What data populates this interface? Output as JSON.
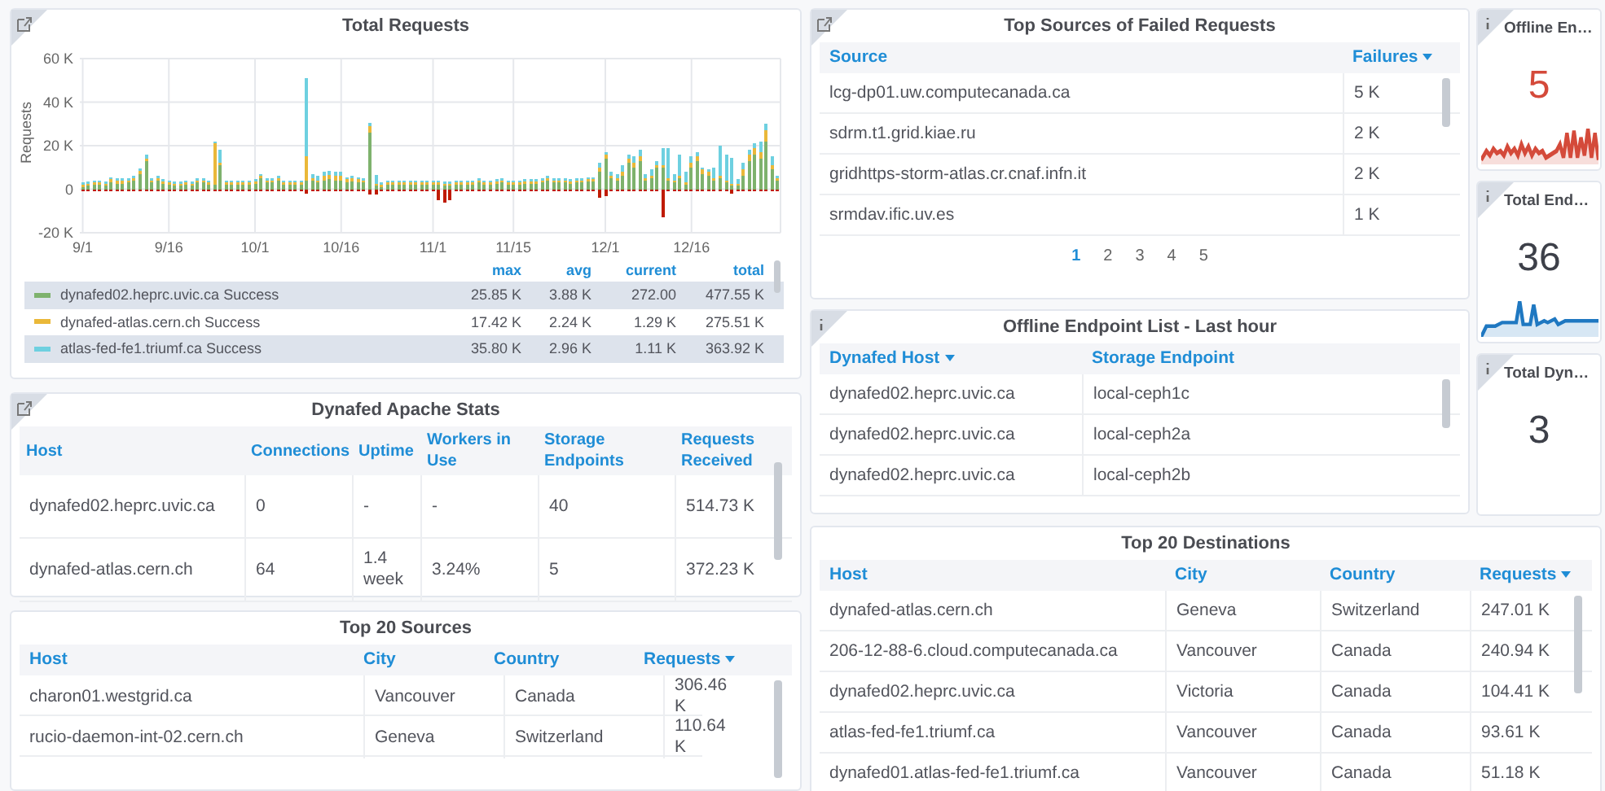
{
  "total_requests": {
    "title": "Total Requests",
    "kind": "link",
    "chart_data": {
      "type": "bar",
      "stacked": true,
      "grid": true,
      "ylabel": "Requests",
      "categories": [
        "9/1",
        null,
        null,
        null,
        null,
        null,
        null,
        null,
        null,
        null,
        null,
        null,
        null,
        null,
        null,
        "9/16",
        null,
        null,
        null,
        null,
        null,
        null,
        null,
        null,
        null,
        null,
        null,
        null,
        null,
        null,
        "10/1",
        null,
        null,
        null,
        null,
        null,
        null,
        null,
        null,
        null,
        null,
        null,
        null,
        null,
        null,
        "10/16",
        null,
        null,
        null,
        null,
        null,
        null,
        null,
        null,
        null,
        null,
        null,
        null,
        null,
        null,
        null,
        "11/1",
        null,
        null,
        null,
        null,
        null,
        null,
        null,
        null,
        null,
        null,
        null,
        null,
        null,
        "11/15",
        null,
        null,
        null,
        null,
        null,
        null,
        null,
        null,
        null,
        null,
        null,
        null,
        null,
        null,
        null,
        "12/1",
        null,
        null,
        null,
        null,
        null,
        null,
        null,
        null,
        null,
        null,
        null,
        null,
        null,
        null,
        "12/16",
        null,
        null,
        null,
        null,
        null,
        null,
        null,
        null,
        null,
        null,
        null,
        null,
        null,
        null,
        null
      ],
      "ylim": [
        -20,
        60
      ],
      "yticks": [
        {
          "value": -20,
          "label": "-20 K"
        },
        {
          "value": 0,
          "label": "0"
        },
        {
          "value": 20,
          "label": "20 K"
        },
        {
          "value": 40,
          "label": "40 K"
        },
        {
          "value": 60,
          "label": "60 K"
        }
      ],
      "series": [
        {
          "color": "#7eb26d",
          "values": [
            1,
            1.5,
            2,
            2,
            1.5,
            3,
            2.5,
            2.5,
            3,
            4,
            7,
            13,
            3,
            4,
            2.5,
            2,
            1.5,
            1.5,
            2,
            1.5,
            3,
            3,
            2,
            2,
            11,
            2,
            2,
            2,
            2,
            2,
            2.5,
            5,
            3,
            3,
            4,
            2,
            2,
            2,
            2,
            4,
            4,
            3,
            4,
            4.5,
            4,
            4,
            3,
            3.5,
            3,
            3,
            26,
            1.5,
            1,
            2,
            2,
            2,
            2,
            2,
            2,
            2,
            2,
            2,
            2,
            1.5,
            1.5,
            2,
            2,
            2,
            2,
            3,
            2,
            2,
            2.5,
            3,
            2,
            2,
            2,
            2.5,
            2.5,
            2.5,
            3,
            4,
            3,
            3,
            3,
            2.5,
            3,
            3,
            3.5,
            3.5,
            8,
            14,
            5,
            4,
            6,
            12,
            10,
            13,
            4,
            5,
            10,
            10,
            4,
            3,
            5,
            2,
            10,
            13,
            7,
            6,
            4,
            5,
            3,
            1.5,
            1.5,
            6,
            13,
            16,
            14,
            22,
            9,
            4
          ]
        },
        {
          "color": "#eab839",
          "values": [
            1,
            1,
            1,
            1,
            1,
            1.5,
            1.5,
            1.5,
            1,
            1,
            1.5,
            1,
            1,
            1,
            1,
            1,
            1,
            1,
            1,
            1,
            1,
            1,
            1,
            19,
            1,
            1,
            1,
            1,
            1,
            1,
            1,
            1,
            1,
            1,
            1,
            1,
            1,
            1,
            1,
            11,
            1,
            1,
            2,
            2,
            2,
            2,
            1.5,
            1.5,
            1.5,
            1,
            3,
            1,
            1,
            1,
            1,
            1,
            1,
            1,
            1,
            1,
            1,
            1,
            1,
            1,
            1,
            1,
            1,
            1,
            1,
            1,
            1,
            1,
            1,
            1,
            1,
            1,
            1,
            1,
            1,
            1,
            1,
            1,
            1,
            1,
            1,
            1,
            1,
            1,
            1,
            1,
            2,
            2,
            1,
            1,
            2,
            2,
            2,
            2,
            1,
            1,
            1,
            1,
            1,
            1,
            1,
            1,
            2,
            2,
            2,
            2,
            1,
            1,
            1,
            1,
            1,
            3,
            3,
            3,
            3,
            5,
            2,
            1
          ]
        },
        {
          "color": "#6ed0e0",
          "values": [
            1,
            1,
            1,
            1,
            1,
            1,
            1,
            1,
            1,
            1,
            1,
            2,
            1,
            1,
            1,
            1,
            1,
            1,
            1,
            1,
            1,
            1,
            1,
            1,
            6,
            1,
            1,
            1,
            1,
            1,
            1,
            1,
            1,
            1,
            1,
            1,
            1,
            1,
            1,
            36,
            2,
            2,
            2,
            2,
            2,
            2,
            1,
            1,
            1,
            1,
            1.5,
            4,
            1,
            1,
            1,
            1,
            1,
            1,
            1,
            1,
            1,
            1,
            1,
            1,
            1,
            1,
            1,
            1,
            1,
            1,
            1,
            1,
            1,
            1,
            1,
            1,
            1,
            1,
            1,
            1,
            1,
            1,
            1,
            1,
            1,
            1,
            1,
            1,
            1,
            1,
            2,
            1,
            2,
            2,
            3,
            2,
            3,
            3,
            2,
            3,
            2,
            8,
            14,
            3,
            10,
            5,
            3,
            2,
            1,
            1,
            5,
            14,
            12,
            12,
            2,
            3,
            2,
            2,
            5,
            3,
            4,
            1
          ]
        },
        {
          "color": "#bf1b00",
          "values": [
            -1,
            -1,
            -1,
            -1,
            -1,
            -1,
            -1,
            -1,
            -1,
            -1,
            -1,
            -1,
            -1,
            -1,
            -1,
            -1,
            -1,
            -1,
            -1,
            -1,
            -1,
            -1,
            -1,
            -1,
            -1,
            -1,
            -1,
            -1,
            -1,
            -1,
            -1,
            -1,
            -1,
            -1,
            -1,
            -1,
            -1,
            -1,
            -1,
            -2,
            -1,
            -1,
            -1,
            -1,
            -1,
            -1,
            -1,
            -1,
            -1,
            -1,
            -2.5,
            -2.5,
            -1,
            -1,
            -1,
            -1,
            -1,
            -1,
            -1,
            -1,
            -1,
            -1,
            -5,
            -6,
            -5,
            -1,
            -1,
            -1,
            -1,
            -1,
            -1,
            -1,
            -1,
            -1,
            -1,
            -1,
            -1,
            -1,
            -1,
            -1,
            -1,
            -1,
            -1,
            -1,
            -1,
            -1,
            -1,
            -1,
            -1,
            -1,
            -4,
            -3,
            -1,
            -1,
            -1,
            -1,
            -1,
            -1,
            -1,
            -1,
            -1,
            -13,
            -1,
            -1,
            -1,
            -1,
            -1,
            -1,
            -1,
            -1,
            -1,
            -1,
            -1,
            -2,
            -1,
            -1,
            -1,
            -1,
            -1,
            -1,
            -1,
            -1
          ]
        }
      ]
    },
    "legend": {
      "columns": [
        "max",
        "avg",
        "current",
        "total"
      ],
      "rows": [
        {
          "color": "#7eb26d",
          "name": "dynafed02.heprc.uvic.ca Success",
          "values": [
            "25.85 K",
            "3.88 K",
            "272.00",
            "477.55 K"
          ]
        },
        {
          "color": "#eab839",
          "name": "dynafed-atlas.cern.ch Success",
          "values": [
            "17.42 K",
            "2.24 K",
            "1.29 K",
            "275.51 K"
          ]
        },
        {
          "color": "#6ed0e0",
          "name": "atlas-fed-fe1.triumf.ca Success",
          "values": [
            "35.80 K",
            "2.96 K",
            "1.11 K",
            "363.92 K"
          ]
        }
      ]
    }
  },
  "dynafed_apache_stats": {
    "title": "Dynafed Apache Stats",
    "kind": "link",
    "columns": [
      {
        "label": "Host",
        "sorted": false
      },
      {
        "label": "Connections",
        "sorted": false
      },
      {
        "label": "Uptime",
        "sorted": false
      },
      {
        "label": "Workers in Use",
        "sorted": false
      },
      {
        "label": "Storage Endpoints",
        "sorted": false
      },
      {
        "label": "Requests Received",
        "sorted": false
      }
    ],
    "rows": [
      [
        "dynafed02.heprc.uvic.ca",
        "0",
        "-",
        "-",
        "40",
        "514.73 K"
      ],
      [
        "dynafed-atlas.cern.ch",
        "64",
        "1.4 week",
        "3.24%",
        "5",
        "372.23 K"
      ]
    ]
  },
  "top_20_sources": {
    "title": "Top 20 Sources",
    "columns": [
      {
        "label": "Host",
        "sorted": false
      },
      {
        "label": "City",
        "sorted": false
      },
      {
        "label": "Country",
        "sorted": false
      },
      {
        "label": "Requests",
        "sorted": true
      }
    ],
    "rows": [
      [
        "charon01.westgrid.ca",
        "Vancouver",
        "Canada",
        "306.46 K"
      ],
      [
        "rucio-daemon-int-02.cern.ch",
        "Geneva",
        "Switzerland",
        "110.64 K"
      ]
    ]
  },
  "top_sources_of_failed_requests": {
    "title": "Top Sources of Failed Requests",
    "kind": "link",
    "columns": [
      {
        "label": "Source",
        "sorted": false
      },
      {
        "label": "Failures",
        "sorted": true
      }
    ],
    "rows": [
      [
        "lcg-dp01.uw.computecanada.ca",
        "5 K"
      ],
      [
        "sdrm.t1.grid.kiae.ru",
        "2 K"
      ],
      [
        "gridhttps-storm-atlas.cr.cnaf.infn.it",
        "2 K"
      ],
      [
        "srmdav.ific.uv.es",
        "1 K"
      ]
    ],
    "pages": [
      {
        "label": "1",
        "selected": true
      },
      {
        "label": "2",
        "selected": false
      },
      {
        "label": "3",
        "selected": false
      },
      {
        "label": "4",
        "selected": false
      },
      {
        "label": "5",
        "selected": false
      }
    ]
  },
  "offline_endpoint_list": {
    "title": "Offline Endpoint List - Last hour",
    "kind": "info",
    "columns": [
      {
        "label": "Dynafed Host",
        "sorted": true
      },
      {
        "label": "Storage Endpoint",
        "sorted": false
      }
    ],
    "rows": [
      [
        "dynafed02.heprc.uvic.ca",
        "local-ceph1c"
      ],
      [
        "dynafed02.heprc.uvic.ca",
        "local-ceph2a"
      ],
      [
        "dynafed02.heprc.uvic.ca",
        "local-ceph2b"
      ]
    ]
  },
  "stats": [
    {
      "title": "Offline En…",
      "kind": "info",
      "value": "5",
      "color": "#d44a3a",
      "sparkline": {
        "color": "#d44a3a"
      }
    },
    {
      "title": "Total End…",
      "kind": "info",
      "value": "36",
      "color": "#3d4049",
      "sparkline": {
        "color": "#1f78c1"
      }
    },
    {
      "title": "Total Dyn…",
      "kind": "info",
      "value": "3",
      "color": "#3d4049"
    }
  ],
  "top_20_destinations": {
    "title": "Top 20 Destinations",
    "columns": [
      {
        "label": "Host",
        "sorted": false
      },
      {
        "label": "City",
        "sorted": false
      },
      {
        "label": "Country",
        "sorted": false
      },
      {
        "label": "Requests",
        "sorted": true
      }
    ],
    "rows": [
      [
        "dynafed-atlas.cern.ch",
        "Geneva",
        "Switzerland",
        "247.01 K"
      ],
      [
        "206-12-88-6.cloud.computecanada.ca",
        "Vancouver",
        "Canada",
        "240.94 K"
      ],
      [
        "dynafed02.heprc.uvic.ca",
        "Victoria",
        "Canada",
        "104.41 K"
      ],
      [
        "atlas-fed-fe1.triumf.ca",
        "Vancouver",
        "Canada",
        "93.61 K"
      ],
      [
        "dynafed01.atlas-fed-fe1.triumf.ca",
        "Vancouver",
        "Canada",
        "51.18 K"
      ]
    ]
  }
}
